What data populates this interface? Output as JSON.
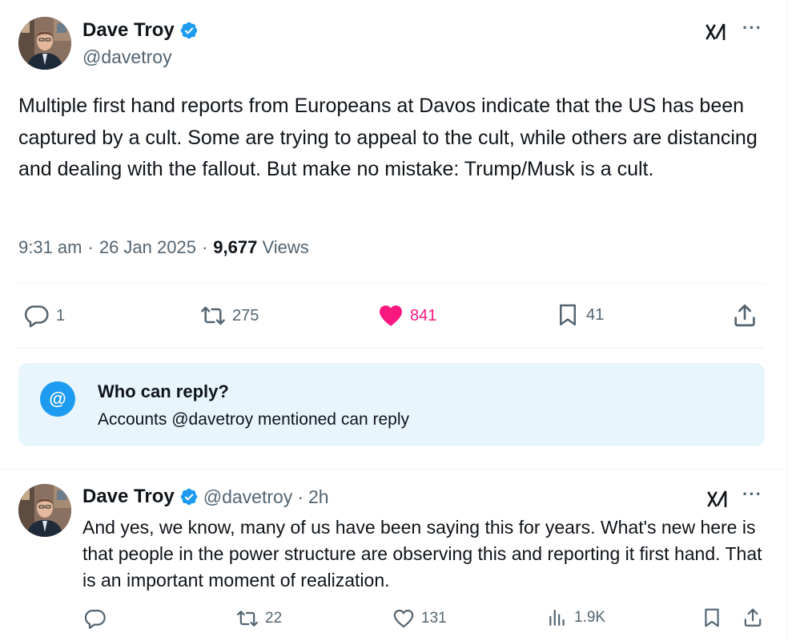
{
  "main_tweet": {
    "author": {
      "name": "Dave Troy",
      "handle": "@davetroy",
      "verified": true
    },
    "text": "Multiple first hand reports from Europeans at Davos indicate that the US has been captured by a cult. Some are trying to appeal to the cult, while others are distancing and dealing with the fallout. But make no mistake: Trump/Musk is a cult.",
    "time": "9:31 am",
    "date": "26 Jan 2025",
    "views_count": "9,677",
    "views_label": "Views",
    "stats": {
      "replies": "1",
      "retweets": "275",
      "likes": "841",
      "bookmarks": "41"
    },
    "who_can_reply": {
      "title": "Who can reply?",
      "subtitle": "Accounts @davetroy mentioned can reply",
      "icon_text": "@"
    }
  },
  "reply_tweet": {
    "author": {
      "name": "Dave Troy",
      "handle": "@davetroy",
      "time_ago": "2h",
      "verified": true
    },
    "text": "And yes, we know, many of us have been saying this for years. What's new here is that people in the power structure are observing this and reporting it first hand. That is an important moment of realization.",
    "stats": {
      "retweets": "22",
      "likes": "131",
      "views": "1.9K"
    }
  },
  "colors": {
    "accent": "#1d9bf0",
    "like": "#f91880",
    "muted": "#536471",
    "reply_box_bg": "#e8f5fd"
  },
  "icons": [
    "verified-badge-icon",
    "grok-icon",
    "more-icon",
    "reply-icon",
    "retweet-icon",
    "like-icon",
    "bookmark-icon",
    "share-icon",
    "views-icon"
  ]
}
